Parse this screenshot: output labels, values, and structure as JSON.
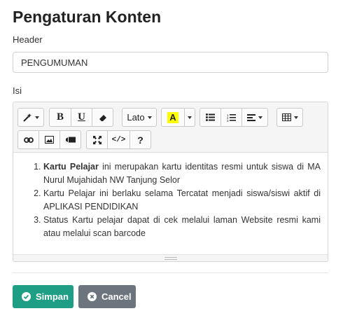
{
  "page": {
    "title": "Pengaturan Konten"
  },
  "form": {
    "header_label": "Header",
    "header_value": "PENGUMUMAN",
    "isi_label": "Isi"
  },
  "toolbar": {
    "font_name": "Lato",
    "color_letter": "A",
    "bold": "B",
    "underline": "U",
    "code": "</>",
    "help": "?",
    "icons": [
      "magic-wand-icon",
      "bold-icon",
      "underline-icon",
      "eraser-icon",
      "font-dropdown",
      "text-color-icon",
      "color-dropdown-icon",
      "unordered-list-icon",
      "ordered-list-icon",
      "align-icon",
      "table-icon",
      "link-icon",
      "picture-icon",
      "video-icon",
      "fullscreen-icon",
      "code-view-icon",
      "help-icon"
    ]
  },
  "content": {
    "items": [
      {
        "bold": "Kartu Pelajar",
        "text": " ini merupakan kartu identitas resmi untuk siswa di MA Nurul Mujahidah NW Tanjung Selor"
      },
      {
        "bold": "",
        "text": "Kartu Pelajar ini berlaku selama Tercatat menjadi siswa/siswi aktif di APLIKASI PENDIDIKAN"
      },
      {
        "bold": "",
        "text": "Status Kartu pelajar dapat di cek melalui laman Website resmi kami atau melalui scan barcode"
      }
    ]
  },
  "actions": {
    "save_label": "Simpan",
    "cancel_label": "Cancel"
  },
  "colors": {
    "save": "#1e9e84",
    "cancel": "#6c757d",
    "highlight": "#ffff00"
  }
}
